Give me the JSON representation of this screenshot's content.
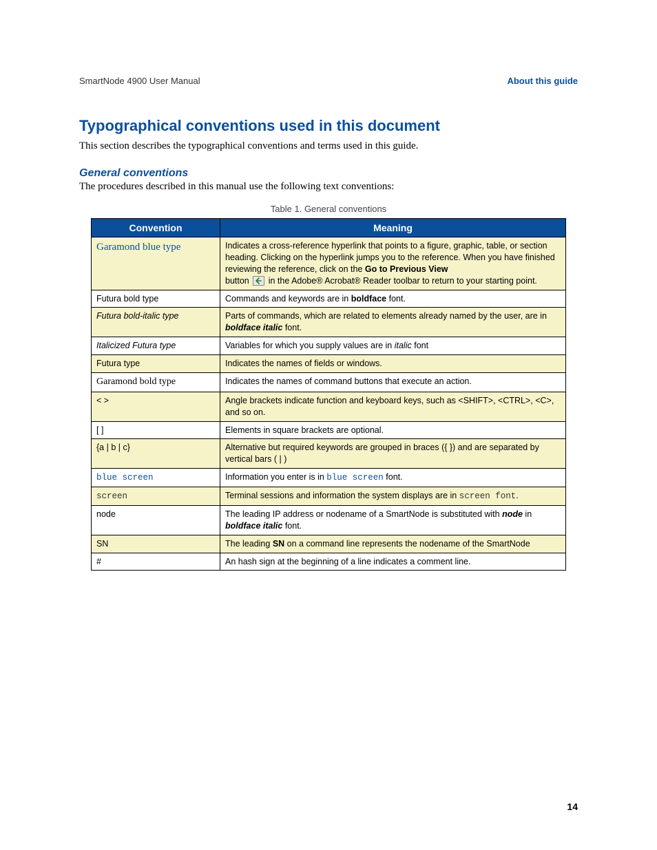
{
  "header": {
    "left": "SmartNode 4900 User Manual",
    "right": "About this guide"
  },
  "section": {
    "title": "Typographical conventions used in this document",
    "intro": "This section describes the typographical conventions and terms used in this guide."
  },
  "subsection": {
    "title": "General conventions",
    "intro": "The procedures described in this manual use the following text conventions:"
  },
  "table": {
    "caption": "Table 1. General conventions",
    "headers": {
      "col1": "Convention",
      "col2": "Meaning"
    },
    "rows": {
      "r0": {
        "conv": "Garamond blue type",
        "m_a": "Indicates a cross-reference hyperlink that points to a figure, graphic, table, or section heading. Clicking on the hyperlink jumps you to the reference. When you have finished reviewing the reference, click on the ",
        "m_b": "Go to Previous View",
        "m_c": " button ",
        "m_d": " in the Adobe® Acrobat® Reader toolbar to return to your starting point."
      },
      "r1": {
        "conv": "Futura bold type",
        "m_a": "Commands and keywords are in ",
        "m_b": "boldface",
        "m_c": " font."
      },
      "r2": {
        "conv": "Futura bold-italic type",
        "m_a": "Parts of commands, which are related to elements already named by the user, are in ",
        "m_b": "boldface italic",
        "m_c": " font."
      },
      "r3": {
        "conv": "Italicized Futura type",
        "m_a": "Variables for which you supply values are in ",
        "m_b": "italic",
        "m_c": " font"
      },
      "r4": {
        "conv": "Futura type",
        "m_a": "Indicates the names of fields or windows."
      },
      "r5": {
        "conv": "Garamond bold type",
        "m_a": "Indicates the names of command buttons that execute an action."
      },
      "r6": {
        "conv": "< >",
        "m_a": "Angle brackets indicate function and keyboard keys, such as <SHIFT>, <CTRL>, <C>, and so on."
      },
      "r7": {
        "conv": "[ ]",
        "m_a": "Elements in square brackets are optional."
      },
      "r8": {
        "conv": "{a | b | c}",
        "m_a": "Alternative but required keywords are grouped in braces ({ }) and are separated by vertical bars ( | )"
      },
      "r9": {
        "conv": "blue screen",
        "m_a": "Information you enter is in ",
        "m_b": "blue screen",
        "m_c": " font."
      },
      "r10": {
        "conv": "screen",
        "m_a": "Terminal sessions and information the system displays are in ",
        "m_b": "screen font",
        "m_c": "."
      },
      "r11": {
        "conv": "node",
        "m_a": "The leading IP address or nodename of a SmartNode is substituted with ",
        "m_b": "node",
        "m_c": " in ",
        "m_d": "boldface italic",
        "m_e": " font."
      },
      "r12": {
        "conv": "SN",
        "m_a": "The leading ",
        "m_b": "SN",
        "m_c": " on a command line represents the nodename of the SmartNode"
      },
      "r13": {
        "conv": "#",
        "m_a": "An hash sign at the beginning of a line indicates a comment line."
      }
    }
  },
  "page_number": "14"
}
